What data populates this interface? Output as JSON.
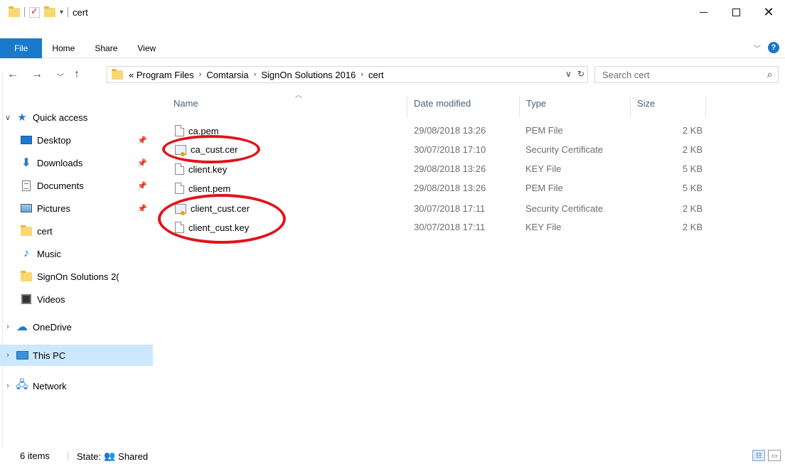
{
  "window": {
    "title": "cert"
  },
  "ribbon": {
    "tabs": [
      "File",
      "Home",
      "Share",
      "View"
    ]
  },
  "address": {
    "breadcrumb": [
      "« Program Files",
      "Comtarsia",
      "SignOn Solutions 2016",
      "cert"
    ],
    "search_placeholder": "Search cert"
  },
  "sidebar": {
    "quick_access": "Quick access",
    "items": [
      {
        "label": "Desktop",
        "icon": "desktop-icon",
        "pinned": true
      },
      {
        "label": "Downloads",
        "icon": "downloads-icon",
        "pinned": true
      },
      {
        "label": "Documents",
        "icon": "documents-icon",
        "pinned": true
      },
      {
        "label": "Pictures",
        "icon": "pictures-icon",
        "pinned": true
      },
      {
        "label": "cert",
        "icon": "folder-icon",
        "pinned": false
      },
      {
        "label": "Music",
        "icon": "music-icon",
        "pinned": false
      },
      {
        "label": "SignOn Solutions 2(",
        "icon": "folder-icon",
        "pinned": false
      },
      {
        "label": "Videos",
        "icon": "videos-icon",
        "pinned": false
      }
    ],
    "onedrive": "OneDrive",
    "this_pc": "This PC",
    "network": "Network"
  },
  "table": {
    "columns": [
      "Name",
      "Date modified",
      "Type",
      "Size"
    ],
    "rows": [
      {
        "name": "ca.pem",
        "date": "29/08/2018 13:26",
        "type": "PEM File",
        "size": "2 KB",
        "icon": "file-icon"
      },
      {
        "name": "ca_cust.cer",
        "date": "30/07/2018 17:10",
        "type": "Security Certificate",
        "size": "2 KB",
        "icon": "certificate-icon"
      },
      {
        "name": "client.key",
        "date": "29/08/2018 13:26",
        "type": "KEY File",
        "size": "5 KB",
        "icon": "file-icon"
      },
      {
        "name": "client.pem",
        "date": "29/08/2018 13:26",
        "type": "PEM File",
        "size": "5 KB",
        "icon": "file-icon"
      },
      {
        "name": "client_cust.cer",
        "date": "30/07/2018 17:11",
        "type": "Security Certificate",
        "size": "2 KB",
        "icon": "certificate-icon"
      },
      {
        "name": "client_cust.key",
        "date": "30/07/2018 17:11",
        "type": "KEY File",
        "size": "2 KB",
        "icon": "file-icon"
      }
    ]
  },
  "status": {
    "items": "6 items",
    "state_label": "State:",
    "state_value": "Shared"
  },
  "colors": {
    "accent": "#1979ca",
    "selected": "#cce8ff",
    "annotation": "#e0141c"
  }
}
